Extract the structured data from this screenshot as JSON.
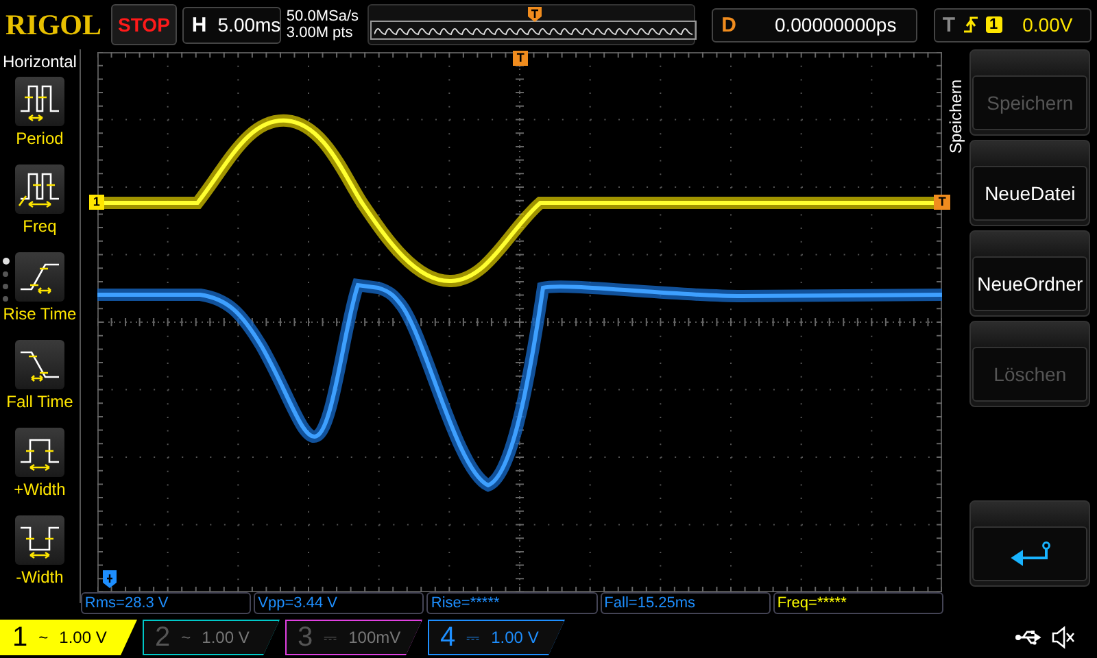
{
  "logo": "RIGOL",
  "run_state": {
    "label": "STOP",
    "running": false
  },
  "timebase": {
    "label": "H",
    "value": "5.00ms"
  },
  "acquisition": {
    "sample_rate": "50.0MSa/s",
    "memory_depth": "3.00M pts"
  },
  "delay": {
    "label": "D",
    "value": "0.00000000ps"
  },
  "trigger": {
    "label": "T",
    "source": "1",
    "level": "0.00V"
  },
  "measure_menu": {
    "title": "Horizontal",
    "items": [
      {
        "label": "Period",
        "kind": "period"
      },
      {
        "label": "Freq",
        "kind": "freq"
      },
      {
        "label": "Rise Time",
        "kind": "rise"
      },
      {
        "label": "Fall Time",
        "kind": "fall"
      },
      {
        "label": "+Width",
        "kind": "pwidth"
      },
      {
        "label": "-Width",
        "kind": "nwidth"
      }
    ],
    "pages": [
      {
        "selected": true
      },
      {
        "selected": false
      },
      {
        "selected": false
      },
      {
        "selected": false
      }
    ]
  },
  "plot_markers": {
    "channel": "1",
    "trigger_right": "T",
    "trigger_top": "T"
  },
  "measurements": [
    {
      "text": "Rms=28.3 V",
      "color": "#1e8fff"
    },
    {
      "text": "Vpp=3.44 V",
      "color": "#1e8fff"
    },
    {
      "text": "Rise=*****",
      "color": "#1e8fff"
    },
    {
      "text": "Fall=15.25ms",
      "color": "#1e8fff"
    },
    {
      "text": "Freq=*****",
      "color": "#ffff00"
    }
  ],
  "channels": [
    {
      "number": "1",
      "coupling": "~",
      "scale": "1.00 V",
      "selected": true,
      "on": true,
      "color": "#ffff00"
    },
    {
      "number": "2",
      "coupling": "~",
      "scale": "1.00 V",
      "selected": false,
      "on": false,
      "color": "#00c8c8"
    },
    {
      "number": "3",
      "coupling": "⎓",
      "scale": "100mV",
      "selected": false,
      "on": false,
      "color": "#e040e0"
    },
    {
      "number": "4",
      "coupling": "⎓",
      "scale": "1.00 V",
      "selected": false,
      "on": true,
      "color": "#1e8fff"
    }
  ],
  "side_menu": {
    "title": "Speichern",
    "buttons": [
      {
        "kind": "text",
        "label": "Speichern",
        "disabled": true
      },
      {
        "kind": "text",
        "label": "NeueDatei",
        "disabled": false
      },
      {
        "kind": "text",
        "label": "NeueOrdner",
        "disabled": false
      },
      {
        "kind": "text",
        "label": "Löschen",
        "disabled": true
      },
      {
        "kind": "spacer"
      },
      {
        "kind": "back"
      }
    ]
  }
}
